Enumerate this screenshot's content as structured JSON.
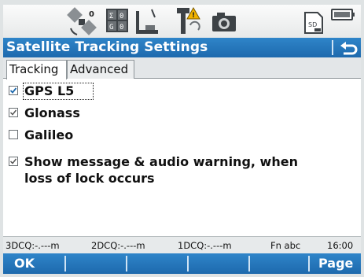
{
  "title": "Satellite Tracking Settings",
  "tabs": [
    {
      "label": "Tracking",
      "active": true
    },
    {
      "label": "Advanced",
      "active": false
    }
  ],
  "options": [
    {
      "label": "GPS L5",
      "checked": true,
      "focused": true
    },
    {
      "label": "Glonass",
      "checked": true,
      "focused": false
    },
    {
      "label": "Galileo",
      "checked": false,
      "focused": false
    },
    {
      "label_line1": "Show message & audio warning, when",
      "label_line2": "loss of lock occurs",
      "checked": true,
      "focused": false
    }
  ],
  "status": {
    "dcq3": "3DCQ:-.---m",
    "dcq2": "2DCQ:-.---m",
    "dcq1": "1DCQ:-.---m",
    "mode": "Fn  abc",
    "time": "16:00"
  },
  "softkeys": {
    "left": "OK",
    "right": "Page"
  },
  "icons": [
    "satellite-icon",
    "dop-icon",
    "antenna-height-icon",
    "gps-receiver-icon",
    "camera-icon",
    "memory-card-icon",
    "battery-icon",
    "back-icon"
  ],
  "colors": {
    "accent": "#1d69ad",
    "accent_light": "#2f85c9"
  }
}
